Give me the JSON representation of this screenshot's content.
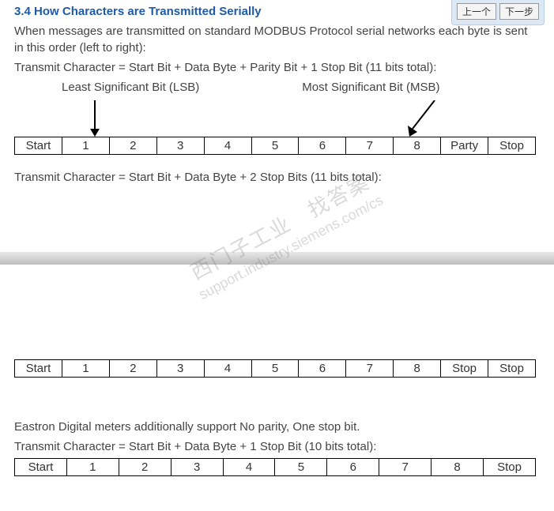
{
  "nav": {
    "prev": "上一个",
    "next": "下一步"
  },
  "section": {
    "number": "3.4",
    "title": "How Characters are Transmitted Serially"
  },
  "intro": "When messages are transmitted on standard MODBUS Protocol serial networks each byte is sent in this order (left to right):",
  "formula1": "Transmit Character = Start Bit + Data Byte + Parity Bit + 1 Stop Bit (11 bits total):",
  "lsb_label": "Least Significant Bit (LSB)",
  "msb_label": "Most Significant Bit (MSB)",
  "table1": [
    "Start",
    "1",
    "2",
    "3",
    "4",
    "5",
    "6",
    "7",
    "8",
    "Party",
    "Stop"
  ],
  "formula2": "Transmit Character = Start Bit + Data Byte + 2 Stop Bits (11 bits total):",
  "table2": [
    "Start",
    "1",
    "2",
    "3",
    "4",
    "5",
    "6",
    "7",
    "8",
    "Stop",
    "Stop"
  ],
  "note3": "Eastron Digital meters additionally support No parity, One stop bit.",
  "formula3": "Transmit Character = Start Bit + Data Byte + 1 Stop Bit (10 bits total):",
  "table3": [
    "Start",
    "1",
    "2",
    "3",
    "4",
    "5",
    "6",
    "7",
    "8",
    "Stop"
  ],
  "watermark": {
    "line1": "西门子工业　找答案",
    "line2": "support.industry.siemens.com/cs"
  }
}
